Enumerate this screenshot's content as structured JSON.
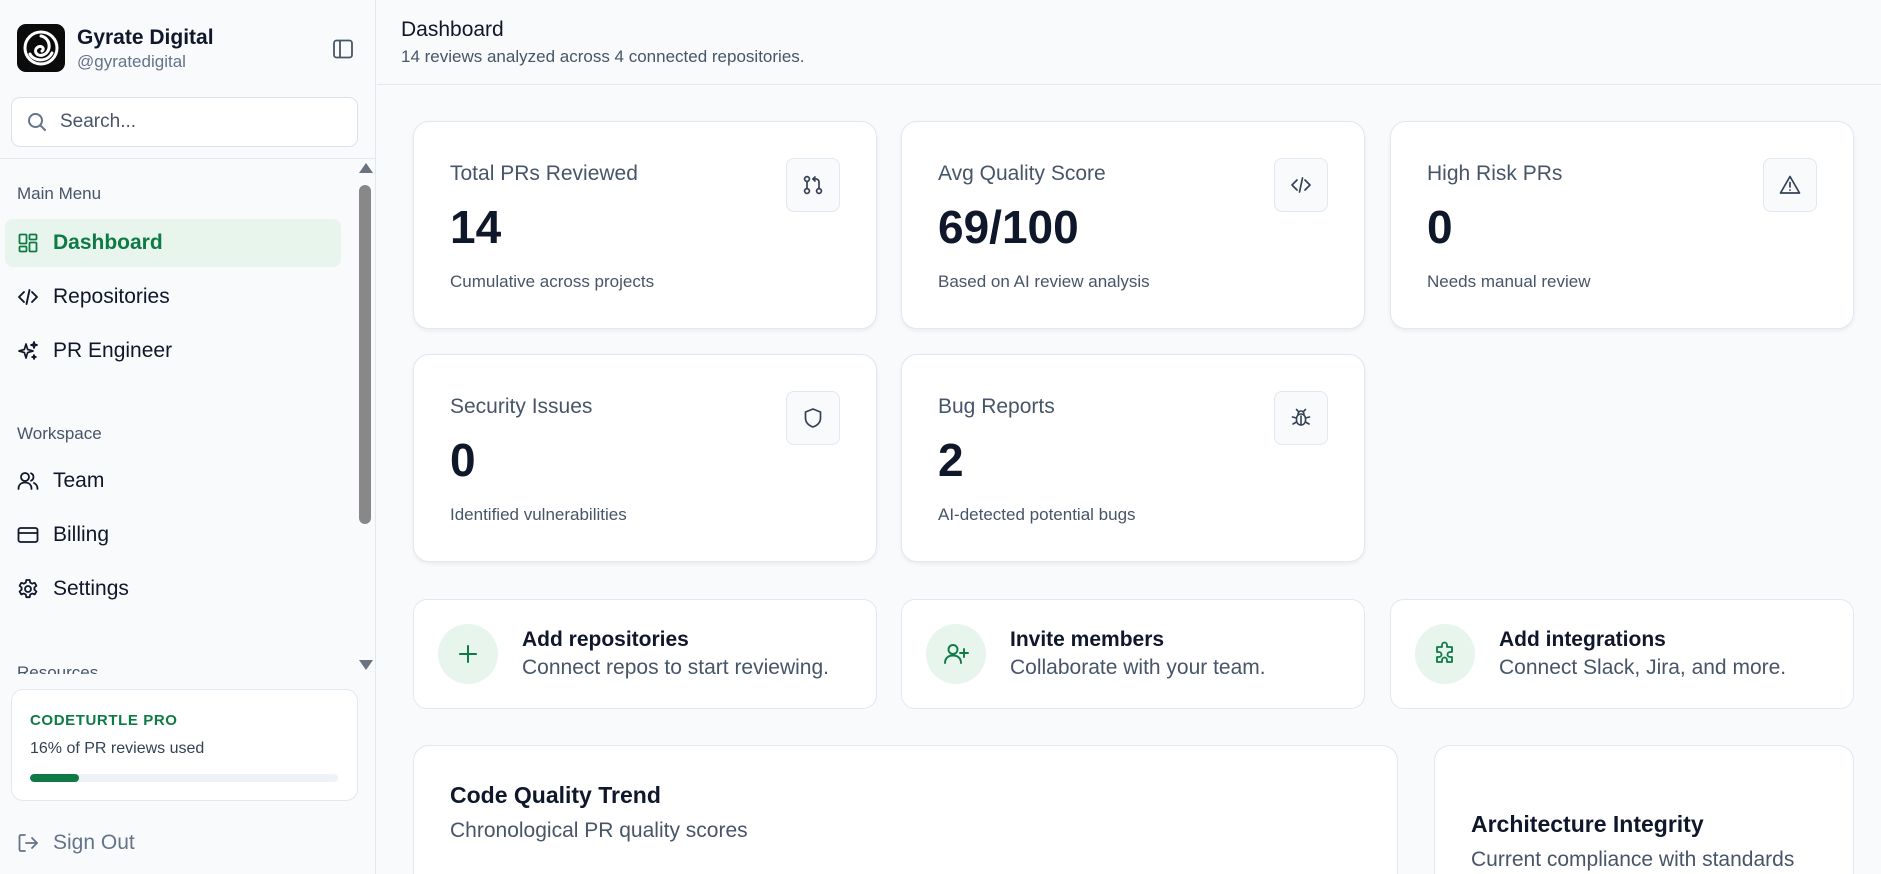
{
  "brand": {
    "name": "Gyrate Digital",
    "handle": "@gyratedigital"
  },
  "search": {
    "placeholder": "Search..."
  },
  "nav": {
    "main_label": "Main Menu",
    "main_items": [
      {
        "label": "Dashboard",
        "icon": "dashboard-icon",
        "active": true
      },
      {
        "label": "Repositories",
        "icon": "code-icon"
      },
      {
        "label": "PR Engineer",
        "icon": "sparkles-icon"
      }
    ],
    "workspace_label": "Workspace",
    "workspace_items": [
      {
        "label": "Team",
        "icon": "users-icon"
      },
      {
        "label": "Billing",
        "icon": "credit-card-icon"
      },
      {
        "label": "Settings",
        "icon": "gear-icon"
      }
    ],
    "resources_label": "Resources"
  },
  "plan": {
    "title": "CODETURTLE PRO",
    "usage_text": "16% of PR reviews used",
    "usage_fraction": 0.16
  },
  "signout": {
    "label": "Sign Out"
  },
  "header": {
    "title": "Dashboard",
    "subtitle": "14 reviews analyzed across 4 connected repositories."
  },
  "stats": [
    {
      "label": "Total PRs Reviewed",
      "value": "14",
      "desc": "Cumulative across projects",
      "icon": "git-pull-request-icon"
    },
    {
      "label": "Avg Quality Score",
      "value": "69/100",
      "desc": "Based on AI review analysis",
      "icon": "code-icon"
    },
    {
      "label": "High Risk PRs",
      "value": "0",
      "desc": "Needs manual review",
      "icon": "warning-icon"
    },
    {
      "label": "Security Issues",
      "value": "0",
      "desc": "Identified vulnerabilities",
      "icon": "shield-icon"
    },
    {
      "label": "Bug Reports",
      "value": "2",
      "desc": "AI-detected potential bugs",
      "icon": "bug-icon"
    }
  ],
  "actions": [
    {
      "title": "Add repositories",
      "desc": "Connect repos to start reviewing.",
      "icon": "plus-icon"
    },
    {
      "title": "Invite members",
      "desc": "Collaborate with your team.",
      "icon": "user-plus-icon"
    },
    {
      "title": "Add integrations",
      "desc": "Connect Slack, Jira, and more.",
      "icon": "puzzle-icon"
    }
  ],
  "panels": {
    "trend": {
      "title": "Code Quality Trend",
      "subtitle": "Chronological PR quality scores"
    },
    "architecture": {
      "title": "Architecture Integrity",
      "subtitle": "Current compliance with standards"
    }
  },
  "colors": {
    "accent": "#0e7a45",
    "accent_soft": "#e8f5ed",
    "text": "#0f172a",
    "muted": "#475569",
    "border": "#e2e8f0"
  }
}
